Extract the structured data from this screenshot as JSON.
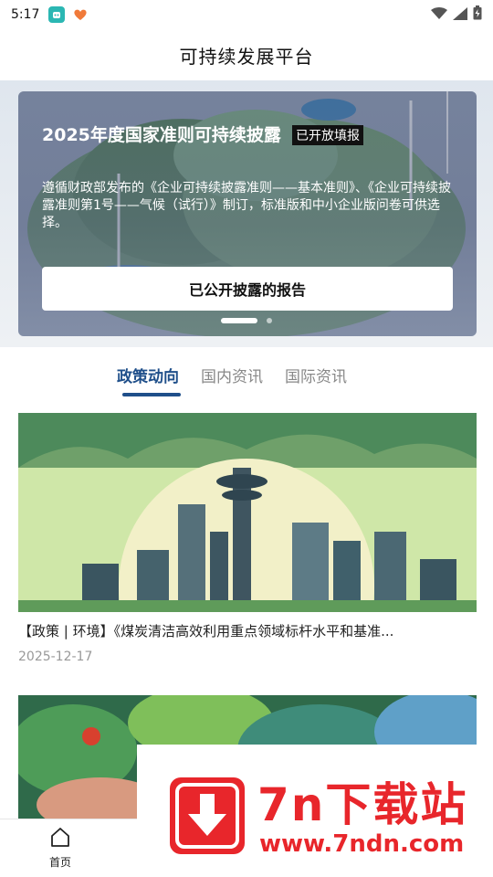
{
  "status_bar": {
    "time": "5:17"
  },
  "header": {
    "title": "可持续发展平台"
  },
  "hero": {
    "title": "2025年度国家准则可持续披露",
    "badge": "已开放填报",
    "description": "遵循财政部发布的《企业可持续披露准则——基本准则》、《企业可持续披露准则第1号——气候（试行）》制订，标准版和中小企业版问卷可供选择。",
    "button_label": "已公开披露的报告",
    "carousel_count": 2,
    "carousel_active": 1
  },
  "tabs": [
    {
      "label": "政策动向",
      "active": true
    },
    {
      "label": "国内资讯",
      "active": false
    },
    {
      "label": "国际资讯",
      "active": false
    }
  ],
  "news": [
    {
      "title": "【政策 | 环境】《煤炭清洁高效利用重点领域标杆水平和基准...",
      "date": "2025-12-17"
    },
    {
      "title": "",
      "date": ""
    }
  ],
  "bottom_nav": {
    "items": [
      {
        "label": "首页",
        "icon": "home-icon"
      }
    ]
  },
  "watermark": {
    "brand": "7n下载站",
    "url": "www.7ndn.com"
  },
  "colors": {
    "accent": "#1f4f8a",
    "watermark_red": "#e8262b"
  }
}
